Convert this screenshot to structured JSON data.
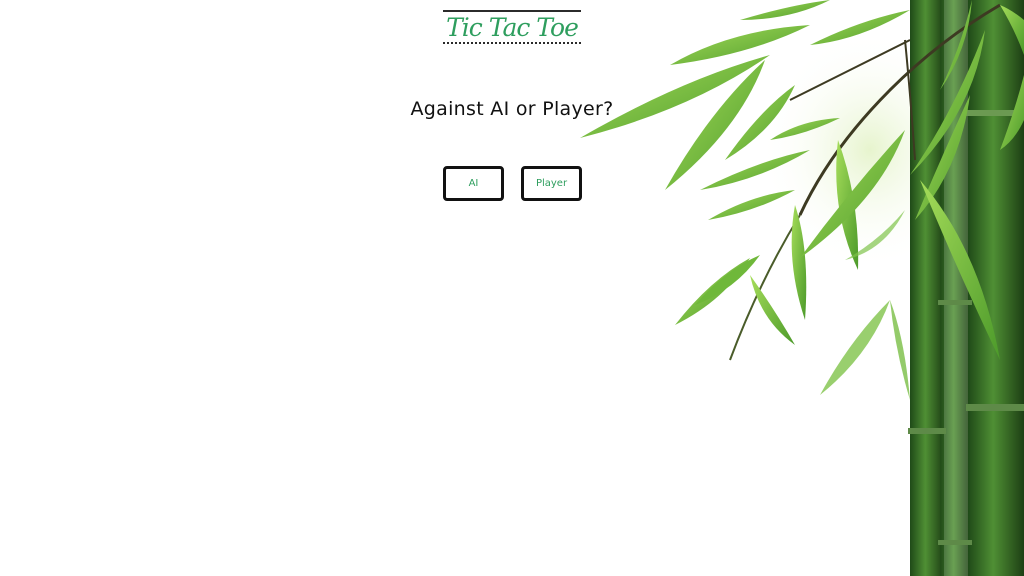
{
  "app": {
    "title": "Tic Tac Toe"
  },
  "prompt": {
    "question": "Against AI or Player?"
  },
  "choices": [
    {
      "label": "AI"
    },
    {
      "label": "Player"
    }
  ],
  "colors": {
    "accent": "#2e9e5e",
    "text": "#111111",
    "border": "#111111",
    "background": "#ffffff",
    "leaf_light": "#8fd14f",
    "leaf_mid": "#5aa832",
    "stalk_dark": "#2f5e22"
  },
  "decoration": {
    "background_image": "bamboo-leaves"
  }
}
